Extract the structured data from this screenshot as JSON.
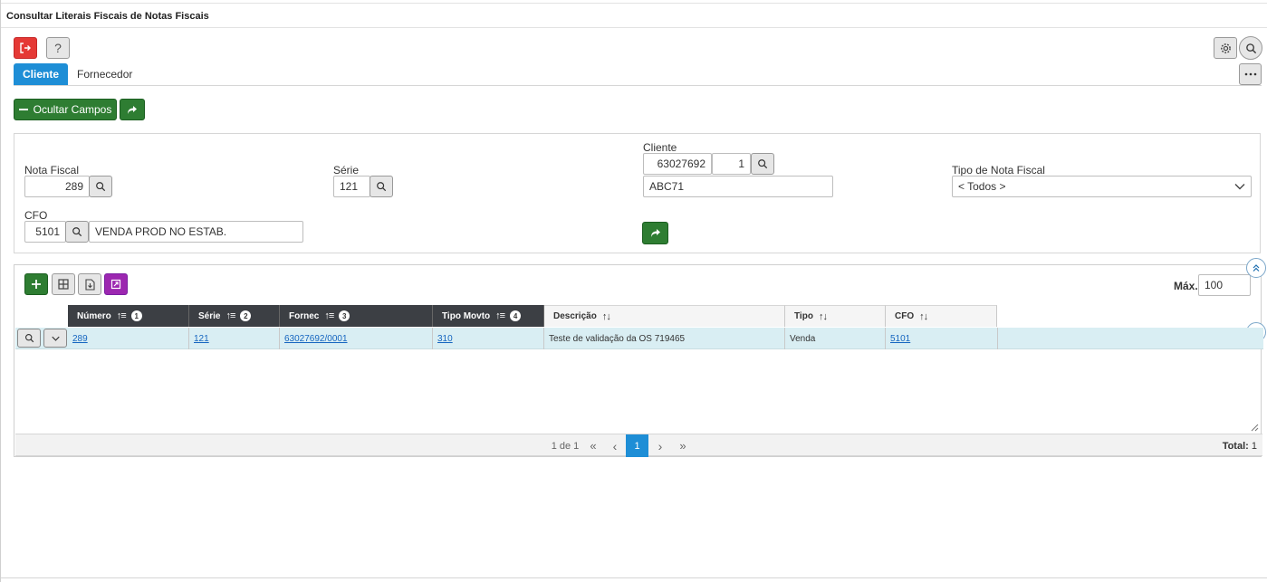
{
  "page": {
    "title": "Consultar Literais Fiscais de Notas Fiscais"
  },
  "tabs": [
    {
      "label": "Cliente",
      "active": true
    },
    {
      "label": "Fornecedor",
      "active": false
    }
  ],
  "actions": {
    "help_label": "?",
    "hide_fields_label": "Ocultar Campos"
  },
  "filters": {
    "nota_fiscal_label": "Nota Fiscal",
    "nota_fiscal_value": "289",
    "serie_label": "Série",
    "serie_value": "121",
    "cliente_label": "Cliente",
    "cliente_code": "63027692",
    "cliente_seq": "1",
    "cliente_name": "ABC71",
    "tipo_label": "Tipo de Nota Fiscal",
    "tipo_value": "< Todos >",
    "cfo_label": "CFO",
    "cfo_value": "5101",
    "cfo_desc": "VENDA PROD NO ESTAB."
  },
  "grid": {
    "max_label": "Máx.",
    "max_value": "100",
    "columns": [
      {
        "label": "Número",
        "order": "1"
      },
      {
        "label": "Série",
        "order": "2"
      },
      {
        "label": "Fornec",
        "order": "3"
      },
      {
        "label": "Tipo Movto",
        "order": "4"
      },
      {
        "label": "Descrição"
      },
      {
        "label": "Tipo"
      },
      {
        "label": "CFO"
      }
    ],
    "rows": [
      {
        "numero": "289",
        "serie": "121",
        "fornec": "63027692/0001",
        "tipo_movto": "310",
        "descricao": "Teste de validação da OS 719465",
        "tipo": "Venda",
        "cfo": "5101"
      }
    ]
  },
  "pager": {
    "page_info": "1 de 1",
    "first": "«",
    "prev": "‹",
    "current": "1",
    "next": "›",
    "last": "»",
    "total_label": "Total:",
    "total_value": "1"
  },
  "colors": {
    "accent": "#1e8ed6",
    "green": "#2e7d32",
    "danger": "#e53935",
    "purple": "#9c27b0",
    "row_highlight": "#d9eef3",
    "header_dark": "#3c3f44"
  }
}
